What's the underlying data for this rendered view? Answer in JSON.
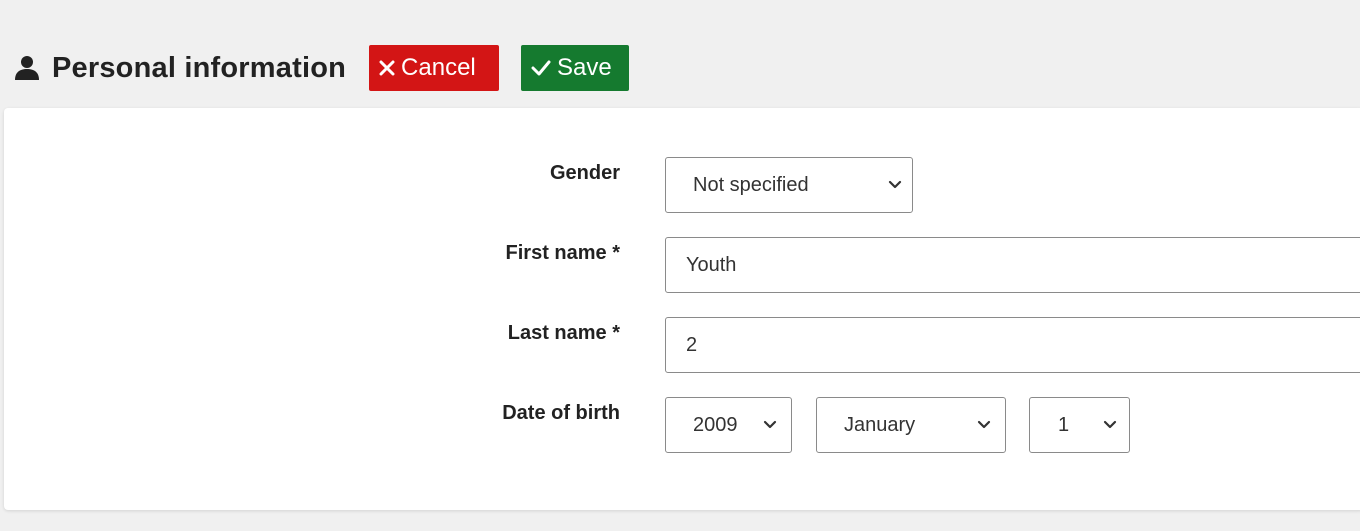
{
  "header": {
    "title": "Personal information",
    "cancel_label": "Cancel",
    "save_label": "Save",
    "icons": {
      "title": "person-icon",
      "cancel": "close-icon",
      "save": "check-icon"
    }
  },
  "form": {
    "gender": {
      "label": "Gender",
      "value": "Not specified"
    },
    "first_name": {
      "label": "First name *",
      "value": "Youth"
    },
    "last_name": {
      "label": "Last name *",
      "value": "2"
    },
    "date_of_birth": {
      "label": "Date of birth",
      "year": "2009",
      "month": "January",
      "day": "1"
    }
  },
  "colors": {
    "cancel": "#d31515",
    "save": "#157a2f",
    "page_background": "#f0f0f0",
    "card_background": "#ffffff"
  }
}
